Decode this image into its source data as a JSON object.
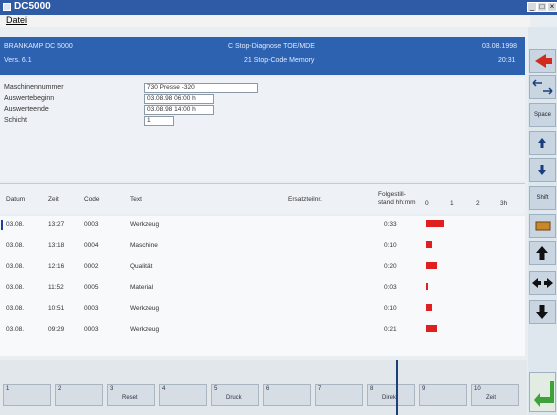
{
  "window": {
    "title": "DC5000"
  },
  "menu": {
    "items": [
      "Datei"
    ]
  },
  "header": {
    "left1": "BRANKAMP  DC 5000",
    "left2": "Vers. 6.1",
    "center1": "C Stop-Diagnose    TOE/MDE",
    "center2": "21  Stop-Code Memory",
    "date": "03.08.1998",
    "time": "20:31"
  },
  "form": {
    "fields": [
      {
        "label": "Maschinennummer",
        "value": "730  Presse -320"
      },
      {
        "label": "Auswertebeginn",
        "value": "03.08.98    06:00 h"
      },
      {
        "label": "Auswerteende",
        "value": "03.08.98    14:00 h"
      },
      {
        "label": "Schicht",
        "value": "1"
      }
    ]
  },
  "table": {
    "headers": {
      "date": "Datum",
      "time": "Zeit",
      "code": "Code",
      "text": "Text",
      "part": "Ersatzteilnr.",
      "stand1": "Folgestill-",
      "stand2": "stand hh:mm",
      "scale": [
        "0",
        "1",
        "2",
        "3h"
      ]
    },
    "rows": [
      {
        "date": "03.08.",
        "time": "13:27",
        "code": "0003",
        "text": "Werkzeug",
        "duration": "0:33",
        "hours": 0.55
      },
      {
        "date": "03.08.",
        "time": "13:18",
        "code": "0004",
        "text": "Maschine",
        "duration": "0:10",
        "hours": 0.17
      },
      {
        "date": "03.08.",
        "time": "12:16",
        "code": "0002",
        "text": "Qualität",
        "duration": "0:20",
        "hours": 0.33
      },
      {
        "date": "03.08.",
        "time": "11:52",
        "code": "0005",
        "text": "Material",
        "duration": "0:03",
        "hours": 0.05
      },
      {
        "date": "03.08.",
        "time": "10:51",
        "code": "0003",
        "text": "Werkzeug",
        "duration": "0:10",
        "hours": 0.17
      },
      {
        "date": "03.08.",
        "time": "09:29",
        "code": "0003",
        "text": "Werkzeug",
        "duration": "0:21",
        "hours": 0.35
      }
    ]
  },
  "side": {
    "buttons": [
      "Space",
      "Shift"
    ]
  },
  "fkeys": [
    {
      "n": "1",
      "label": ""
    },
    {
      "n": "2",
      "label": ""
    },
    {
      "n": "3",
      "label": "Reset"
    },
    {
      "n": "4",
      "label": ""
    },
    {
      "n": "5",
      "label": "Druck"
    },
    {
      "n": "6",
      "label": ""
    },
    {
      "n": "7",
      "label": ""
    },
    {
      "n": "8",
      "label": "Direkt"
    },
    {
      "n": "9",
      "label": ""
    },
    {
      "n": "10",
      "label": "Zeit"
    }
  ],
  "colors": {
    "bar": "#e02020",
    "header": "#2d62b0",
    "title": "#2f5aa6"
  }
}
